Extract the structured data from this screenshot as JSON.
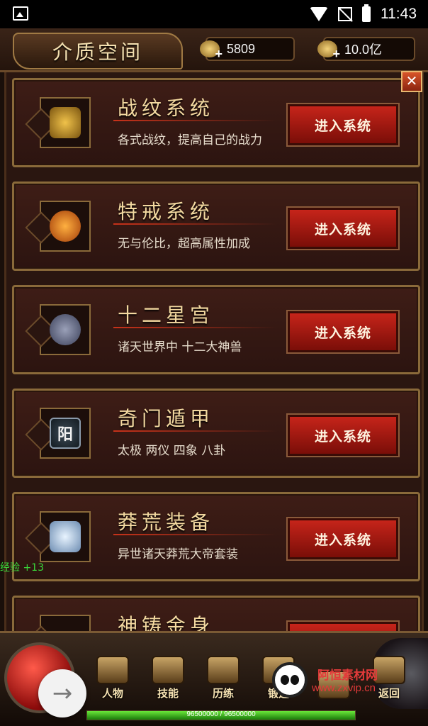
{
  "status_bar": {
    "time": "11:43"
  },
  "header": {
    "title": "介质空间",
    "coin_value": "5809",
    "gold_value": "10.0亿",
    "close_label": "✕"
  },
  "systems": [
    {
      "name": "战纹系统",
      "desc": "各式战纹，提高自己的战力",
      "button": "进入系统",
      "icon_glyph": ""
    },
    {
      "name": "特戒系统",
      "desc": "无与伦比，超高属性加成",
      "button": "进入系统",
      "icon_glyph": ""
    },
    {
      "name": "十二星宫",
      "desc": "诸天世界中 十二大神兽",
      "button": "进入系统",
      "icon_glyph": ""
    },
    {
      "name": "奇门遁甲",
      "desc": "太极 两仪 四象 八卦",
      "button": "进入系统",
      "icon_glyph": "阳"
    },
    {
      "name": "莽荒装备",
      "desc": "异世诸天莽荒大帝套装",
      "button": "进入系统",
      "icon_glyph": ""
    },
    {
      "name": "神铸金身",
      "desc": "",
      "button": "",
      "icon_glyph": ""
    }
  ],
  "exp_notice": "经验 +13",
  "bottom_nav": [
    {
      "label": "人物"
    },
    {
      "label": "技能"
    },
    {
      "label": "历练"
    },
    {
      "label": "锻造"
    },
    {
      "label": ""
    },
    {
      "label": "返回"
    }
  ],
  "xp": {
    "text": "96500000 / 96500000",
    "fill_fraction": 1.0
  },
  "watermark": {
    "line1": "阿恒素材网",
    "line2": "www.zxvip.cn"
  },
  "colors": {
    "accent_red": "#c6241a",
    "gold_text": "#f3d9a0",
    "xp_green": "#6ae83a"
  }
}
